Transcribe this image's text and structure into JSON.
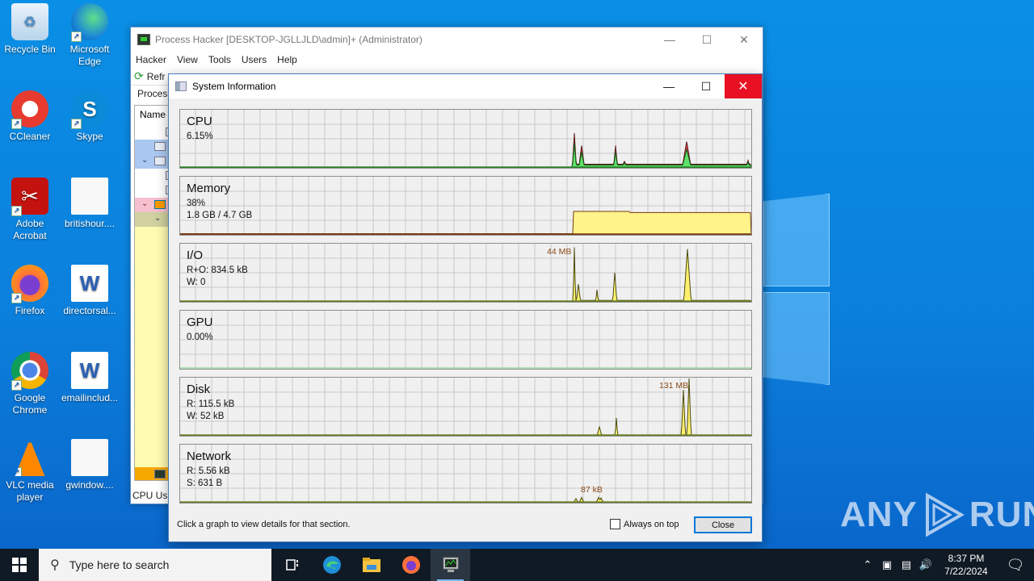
{
  "desktop": {
    "icons": [
      {
        "label": "Recycle Bin",
        "icon": "recycle-bin-icon"
      },
      {
        "label": "Microsoft Edge",
        "icon": "edge-icon"
      },
      {
        "label": "CCleaner",
        "icon": "ccleaner-icon"
      },
      {
        "label": "Skype",
        "icon": "skype-icon"
      },
      {
        "label": "Adobe Acrobat",
        "icon": "acrobat-icon"
      },
      {
        "label": "britishour....",
        "icon": "image-file-icon"
      },
      {
        "label": "Firefox",
        "icon": "firefox-icon"
      },
      {
        "label": "directorsal...",
        "icon": "word-doc-icon"
      },
      {
        "label": "Google Chrome",
        "icon": "chrome-icon"
      },
      {
        "label": "emailinclud...",
        "icon": "word-doc-icon"
      },
      {
        "label": "VLC media player",
        "icon": "vlc-icon"
      },
      {
        "label": "gwindow....",
        "icon": "image-file-icon"
      }
    ],
    "watermark": "ANY RUN"
  },
  "process_hacker": {
    "title": "Process Hacker [DESKTOP-JGLLJLD\\admin]+ (Administrator)",
    "menu": [
      "Hacker",
      "View",
      "Tools",
      "Users",
      "Help"
    ],
    "toolbar_refresh": "Refr",
    "tab": "Process",
    "column_header": "Name",
    "status": "CPU Usa"
  },
  "sysinfo": {
    "title": "System Information",
    "footer_hint": "Click a graph to view details for that section.",
    "always_on_top_label": "Always on top",
    "always_on_top_checked": false,
    "close_label": "Close",
    "graphs": [
      {
        "name": "CPU",
        "line1": "6.15%",
        "line2": "",
        "peak": ""
      },
      {
        "name": "Memory",
        "line1": "38%",
        "line2": "1.8 GB / 4.7 GB",
        "peak": ""
      },
      {
        "name": "I/O",
        "line1": "R+O: 834.5 kB",
        "line2": "W: 0",
        "peak": "44 MB"
      },
      {
        "name": "GPU",
        "line1": "0.00%",
        "line2": "",
        "peak": ""
      },
      {
        "name": "Disk",
        "line1": "R: 115.5 kB",
        "line2": "W: 52 kB",
        "peak": "131 MB"
      },
      {
        "name": "Network",
        "line1": "R: 5.56 kB",
        "line2": "S: 631 B",
        "peak": "87 kB"
      }
    ],
    "colors": {
      "cpu_kernel": "#e04040",
      "cpu_user": "#5fe06a",
      "memory_fill": "#fff38a",
      "memory_line": "#7a3a10",
      "io_fill": "#fff070",
      "grid": "#c8c8c8",
      "baseline": "#6f8a2a"
    }
  },
  "taskbar": {
    "search_placeholder": "Type here to search",
    "pinned": [
      "task-view",
      "edge",
      "file-explorer",
      "firefox",
      "process-hacker"
    ],
    "time": "8:37 PM",
    "date": "7/22/2024"
  }
}
